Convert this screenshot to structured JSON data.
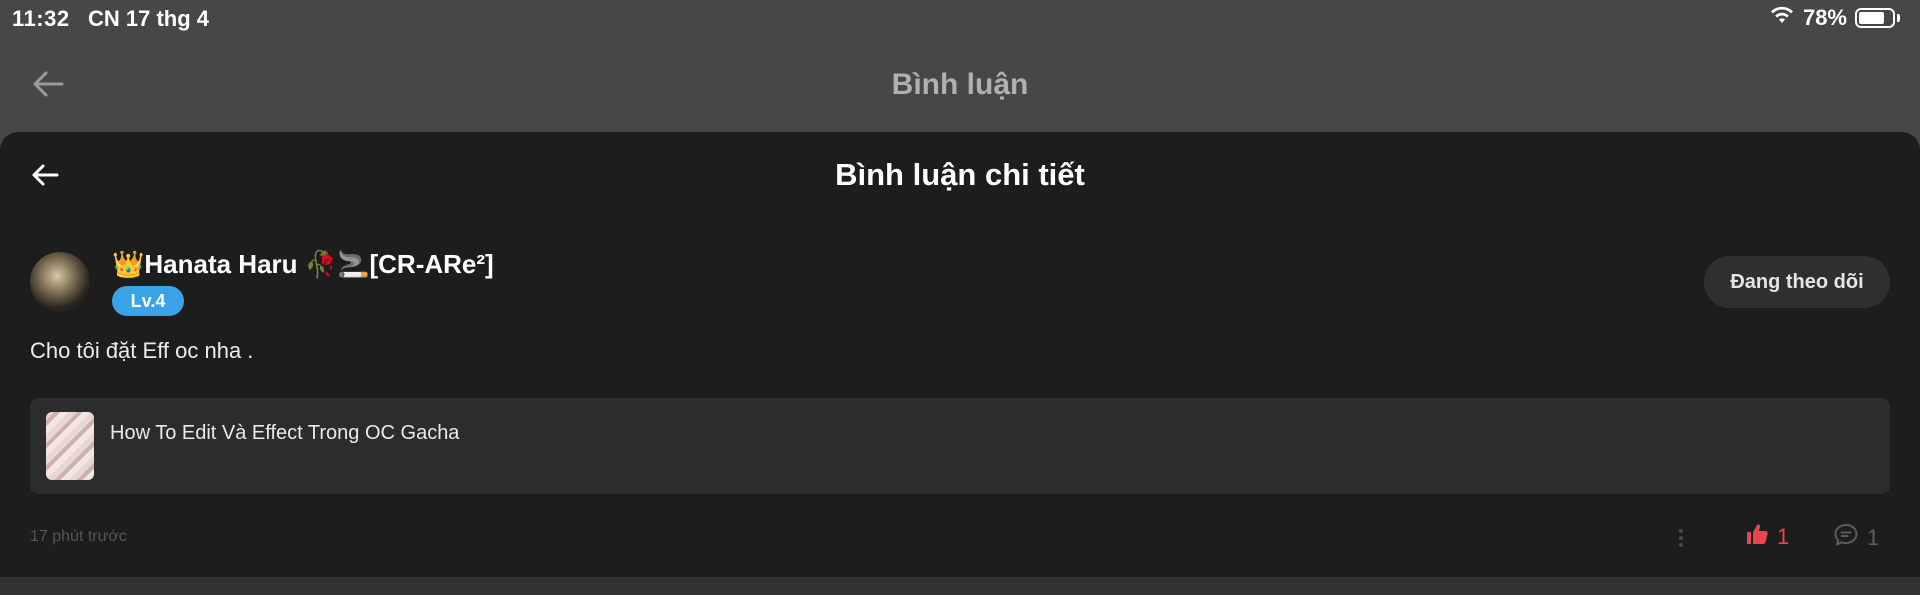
{
  "status_bar": {
    "time": "11:32",
    "date": "CN 17 thg 4",
    "battery_percent": "78%",
    "battery_level": 0.78,
    "icons": [
      "wifi-icon",
      "battery-icon"
    ]
  },
  "background_header": {
    "title": "Bình luận",
    "back_icon": "arrow-left-icon"
  },
  "sheet": {
    "title": "Bình luận chi tiết",
    "back_icon": "arrow-left-icon"
  },
  "comment": {
    "author_name": "👑Hanata Haru 🥀🚬[CR-ARe²]",
    "level": "Lv.4",
    "follow_label": "Đang theo dõi",
    "text": "Cho tôi đặt Eff oc nha .",
    "linked_post_title": "How To Edit Và Effect Trong OC Gacha",
    "timestamp": "17 phút trước",
    "like_count": "1",
    "reply_count": "1"
  },
  "colors": {
    "background": "#474747",
    "sheet": "#1d1d1d",
    "level_badge": "#3aa3e8",
    "like": "#e8454e"
  }
}
